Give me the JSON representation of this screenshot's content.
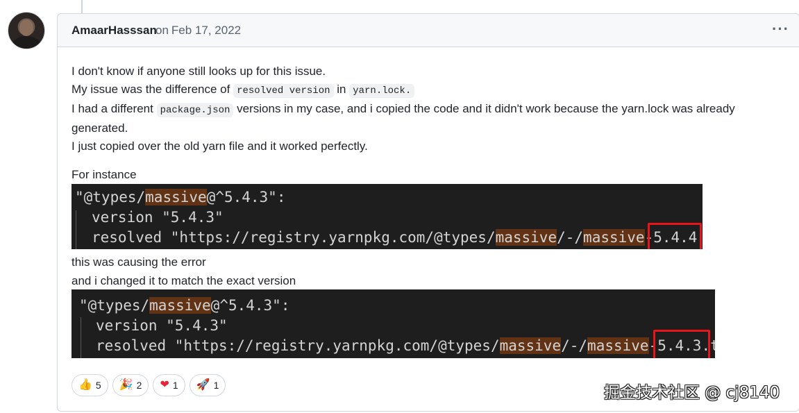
{
  "comment": {
    "author": "AmaarHasssan",
    "on_word": "on",
    "date": "Feb 17, 2022",
    "menu_icon": "kebab-horizontal-icon"
  },
  "body": {
    "line1": "I don't know if anyone still looks up for this issue.",
    "line2_pre": "My issue was the difference of",
    "line2_code1": "resolved version",
    "line2_mid": "in",
    "line2_code2": "yarn.lock.",
    "line3_pre": "I had a different",
    "line3_code": "package.json",
    "line3_post": "versions in my case, and i copied the code and it didn't work because the yarn.lock was already generated.",
    "line4": "I just copied over the old yarn file and it worked perfectly.",
    "for_instance": "For instance",
    "causing_error": "this was causing the error",
    "changed_it": "and i changed it to match the exact version"
  },
  "code1": {
    "l1_a": "\"@types/",
    "l1_hl": "massive",
    "l1_b": "@^5.4.3\":",
    "l2": "version \"5.4.3\"",
    "l3_a": "resolved \"https://registry.yarnpkg.com/@types/",
    "l3_hl1": "massive",
    "l3_b": "/-/",
    "l3_hl2": "massive",
    "l3_c": "-",
    "l3_ver": "5.4.4"
  },
  "code2": {
    "l1_a": "\"@types/",
    "l1_hl": "massive",
    "l1_b": "@^5.4.3\":",
    "l2": "version \"5.4.3\"",
    "l3_a": "resolved \"https://registry.yarnpkg.com/@types/",
    "l3_hl1": "massive",
    "l3_b": "/-/",
    "l3_hl2": "massive",
    "l3_c": "-",
    "l3_ver": "5.4.3",
    "l3_d": ".t"
  },
  "reactions": [
    {
      "icon": "thumbs-up-icon",
      "glyph": "👍",
      "count": "5"
    },
    {
      "icon": "tada-icon",
      "glyph": "🎉",
      "count": "2"
    },
    {
      "icon": "heart-icon",
      "glyph": "❤",
      "count": "1"
    },
    {
      "icon": "rocket-icon",
      "glyph": "🚀",
      "count": "1"
    }
  ],
  "watermark": "掘金技术社区 @ cj8140",
  "colors": {
    "border": "#d0d7de",
    "header_bg": "#f6f8fa",
    "code_bg": "#1e1e1e",
    "highlight": "#613214",
    "box": "#e8151b"
  }
}
